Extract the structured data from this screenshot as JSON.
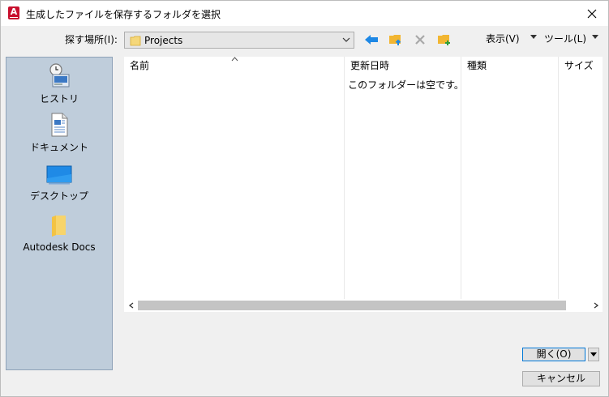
{
  "window": {
    "title": "生成したファイルを保存するフォルダを選択",
    "app_icon_letter": "A"
  },
  "toolbar": {
    "look_in_label": "探す場所(I):",
    "look_in_value": "Projects",
    "view_menu": "表示(V)",
    "tools_menu": "ツール(L)",
    "icons": [
      "back-arrow-icon",
      "folder-up-icon",
      "delete-icon",
      "new-folder-icon"
    ]
  },
  "places": [
    {
      "label": "ヒストリ",
      "icon": "history-icon"
    },
    {
      "label": "ドキュメント",
      "icon": "documents-icon"
    },
    {
      "label": "デスクトップ",
      "icon": "desktop-icon"
    },
    {
      "label": "Autodesk Docs",
      "icon": "folder-icon"
    }
  ],
  "file_list": {
    "columns": [
      "名前",
      "更新日時",
      "種類",
      "サイズ"
    ],
    "empty_message": "このフォルダーは空です。"
  },
  "buttons": {
    "open": "開く(O)",
    "cancel": "キャンセル"
  },
  "colors": {
    "places_bg": "#bfcddb",
    "accent_blue": "#0078d7",
    "folder_yellow": "#f5c542",
    "app_red": "#c8102e"
  }
}
